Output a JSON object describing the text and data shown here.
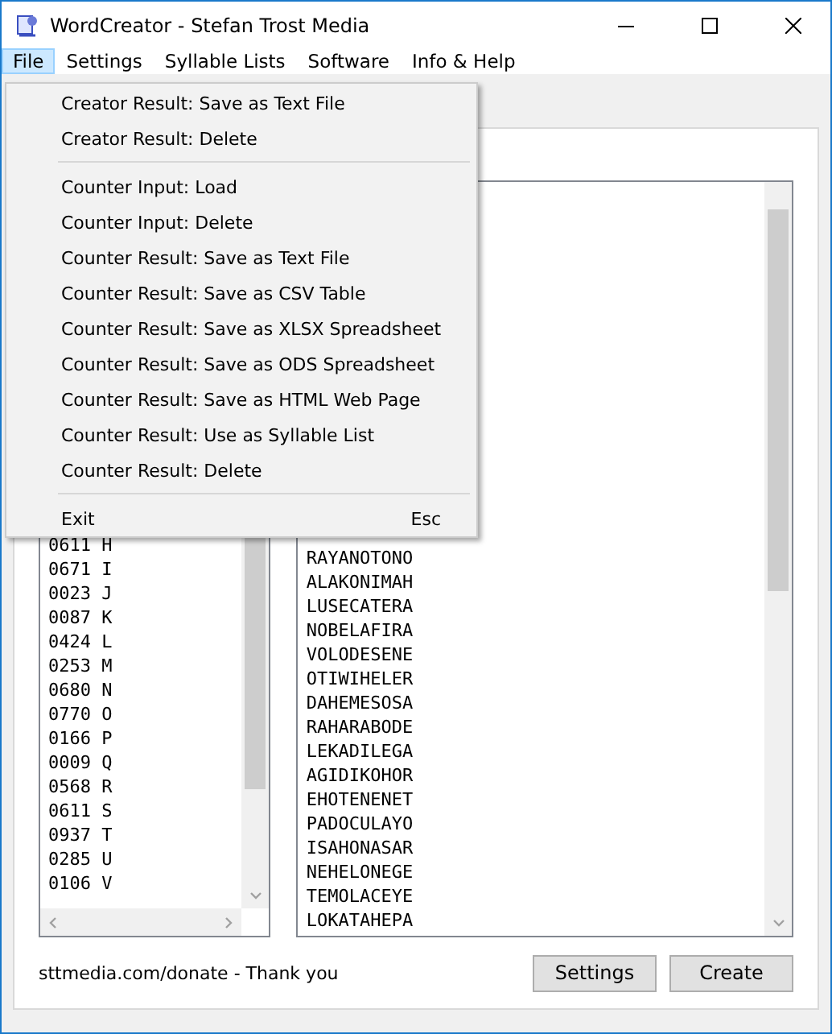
{
  "window": {
    "title": "WordCreator - Stefan Trost Media"
  },
  "menu_bar": [
    {
      "label": "File",
      "selected": true
    },
    {
      "label": "Settings",
      "selected": false
    },
    {
      "label": "Syllable Lists",
      "selected": false
    },
    {
      "label": "Software",
      "selected": false
    },
    {
      "label": "Info & Help",
      "selected": false
    }
  ],
  "file_menu": [
    {
      "kind": "item",
      "label": "Creator Result: Save as Text File"
    },
    {
      "kind": "item",
      "label": "Creator Result: Delete"
    },
    {
      "kind": "separator"
    },
    {
      "kind": "item",
      "label": "Counter Input: Load"
    },
    {
      "kind": "item",
      "label": "Counter Input: Delete"
    },
    {
      "kind": "item",
      "label": "Counter Result: Save as Text File"
    },
    {
      "kind": "item",
      "label": "Counter Result: Save as CSV Table"
    },
    {
      "kind": "item",
      "label": "Counter Result: Save as XLSX Spreadsheet"
    },
    {
      "kind": "item",
      "label": "Counter Result: Save as ODS Spreadsheet"
    },
    {
      "kind": "item",
      "label": "Counter Result: Save as HTML Web Page"
    },
    {
      "kind": "item",
      "label": "Counter Result: Use as Syllable List"
    },
    {
      "kind": "item",
      "label": "Counter Result: Delete"
    },
    {
      "kind": "separator"
    },
    {
      "kind": "item",
      "label": "Exit",
      "shortcut": "Esc"
    }
  ],
  "letter_counts": [
    "0611 H",
    "0671 I",
    "0023 J",
    "0087 K",
    "0424 L",
    "0253 M",
    "0680 N",
    "0770 O",
    "0166 P",
    "0009 Q",
    "0568 R",
    "0611 S",
    "0937 T",
    "0285 U",
    "0106 V"
  ],
  "created_words": [
    "RAYANOTONO",
    "ALAKONIMAH",
    "LUSECATERA",
    "NOBELAFIRA",
    "VOLODESENE",
    "OTIWIHELER",
    "DAHEMESOSA",
    "RAHARABODE",
    "LEKADILEGA",
    "AGIDIKOHOR",
    "EHOTENENET",
    "PADOCULAYO",
    "ISAHONASAR",
    "NEHELONEGE",
    "TEMOLACEYE",
    "LOKATAHEPA"
  ],
  "footer": {
    "donate": "sttmedia.com/donate - Thank you",
    "buttons": [
      "Settings",
      "Create"
    ]
  }
}
